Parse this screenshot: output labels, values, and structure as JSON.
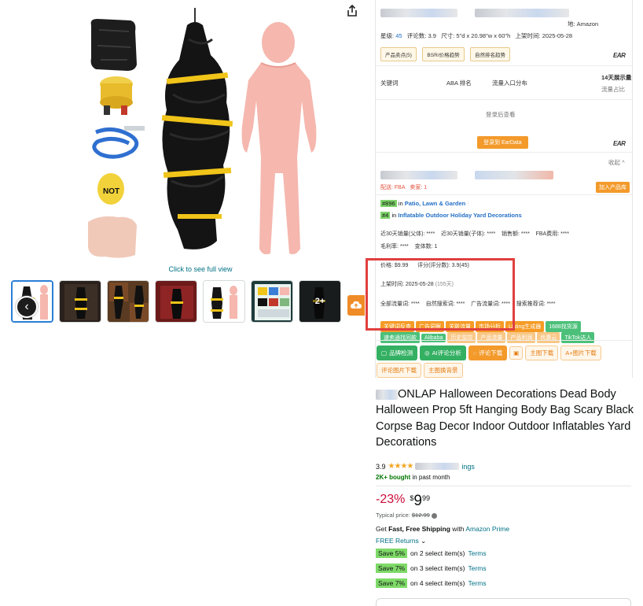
{
  "gallery": {
    "click_full": "Click to see full view",
    "more_label": "2+",
    "thumbnail_count": 7
  },
  "panel": {
    "top": {
      "origin_label": "地: Amazon",
      "stars_label": "星级:",
      "stars_value": "45",
      "review_label": "评论数:",
      "review_value": "3.9",
      "size_label": "尺寸:",
      "size_value": "5\"d x 20.98\"w x 60\"h",
      "listed_label": "上架时间:",
      "listed_value": "2025-05-28",
      "tabs": [
        "产品卖点(5)",
        "BSR/价格趋势",
        "自然排名趋势"
      ],
      "brand": "EAR"
    },
    "keywords": {
      "col1": "关键词",
      "col2": "ABA 排名",
      "col3": "流量入口分布",
      "col4": "14天展示量",
      "col4_sub": "流量占比",
      "login_hint": "登录后查看",
      "login_button": "登录到 EarData",
      "brand": "EAR"
    },
    "seller": {
      "collapse": "收起",
      "delivery": "配送: FBA",
      "sellers": "卖家: 1",
      "add_pool": "加入产品库",
      "rank1_badge": "#896",
      "rank1_in": "in",
      "rank1_cat": "Patio, Lawn & Garden",
      "rank2_badge": "#4",
      "rank2_in": "in",
      "rank2_cat": "Inflatable Outdoor Holiday Yard Decorations"
    },
    "stats": {
      "line1": "近30天销量(父体): ****    近30天销量(子体): ****    销售额: ****    FBA费用: ****",
      "line2": "毛利率: ****    变体数: 1",
      "price_line": "价格: $9.99      评分(评分数): 3.9(45)",
      "listed_line": "上架时间: 2025-05-28",
      "listed_days": "(155天)",
      "search_line": "全部流量词: ****    自然搜索词: ****    广告流量词: ****    搜索推荐词: ****"
    },
    "pills": {
      "orange": [
        "关键词反查",
        "广告洞察",
        "关联流量",
        "市场分析",
        "Listing生成器"
      ],
      "green_row1": [
        "1688找货源"
      ],
      "green_row2": [
        "速卖通找同款",
        "Alibaba"
      ],
      "orange_row2": [
        "历史监控",
        "产品流量",
        "产品利润",
        "优惠云"
      ],
      "green_end": [
        "TikTok达人"
      ]
    },
    "actions": {
      "brand_check": "品牌检测",
      "ai_review": "AI评论分析",
      "review_download": "评论下载",
      "main_download": "主图下载",
      "aplus_download": "A+图片下载",
      "review_images": "评论图片下载",
      "bg_remove": "主图换背景"
    }
  },
  "product": {
    "title_visible": "ONLAP Halloween Decorations Dead Body Halloween Prop 5ft Hanging Body Bag Scary Black Corpse Bag Decor Indoor Outdoor Inflatables Yard Decorations",
    "rating": "3.9",
    "stars_glyph": "★★★★",
    "ratings_suffix": "ings",
    "bought_bold": "2K+ bought",
    "bought_rest": " in past month",
    "discount": "-23%",
    "price_whole": "9",
    "price_symbol": "$",
    "price_fraction": "99",
    "typical_label": "Typical price:",
    "typical_value": "$12.99",
    "shipping_pre": "Get ",
    "shipping_bold": "Fast, Free Shipping",
    "shipping_mid": " with ",
    "shipping_link": "Amazon Prime",
    "returns": "FREE Returns",
    "save_offers": [
      {
        "badge": "Save 5%",
        "text": "on 2 select item(s)",
        "link": "Terms"
      },
      {
        "badge": "Save 7%",
        "text": "on 3 select item(s)",
        "link": "Terms"
      },
      {
        "badge": "Save 7%",
        "text": "on 4 select item(s)",
        "link": "Terms"
      }
    ]
  },
  "colors": {
    "accent_orange": "#f39a2b",
    "accent_green": "#34b063",
    "discount_red": "#cc0c39",
    "annotation_red": "#e0403f",
    "link_teal": "#007185"
  }
}
